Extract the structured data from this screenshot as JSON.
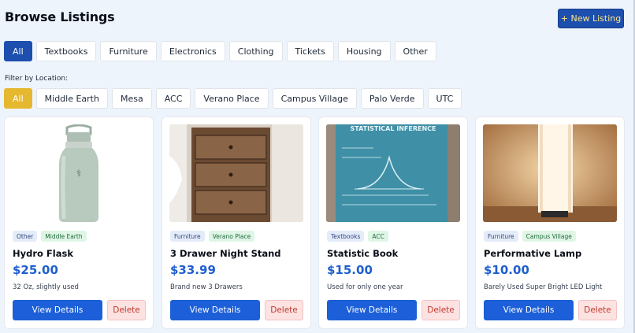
{
  "header": {
    "title": "Browse Listings",
    "new_listing_label": "+ New Listing"
  },
  "categories": [
    "All",
    "Textbooks",
    "Furniture",
    "Electronics",
    "Clothing",
    "Tickets",
    "Housing",
    "Other"
  ],
  "selected_category": "All",
  "location_filter": {
    "label": "Filter by Location:",
    "options": [
      "All",
      "Middle Earth",
      "Mesa",
      "ACC",
      "Verano Place",
      "Campus Village",
      "Palo Verde",
      "UTC"
    ],
    "selected": "All"
  },
  "listings": [
    {
      "category": "Other",
      "location": "Middle Earth",
      "title": "Hydro Flask",
      "price": "$25.00",
      "description": "32 Oz, slightly used",
      "image": "water-bottle-photo"
    },
    {
      "category": "Furniture",
      "location": "Verano Place",
      "title": "3 Drawer Night Stand",
      "price": "$33.99",
      "description": "Brand new 3 Drawers",
      "image": "nightstand-photo"
    },
    {
      "category": "Textbooks",
      "location": "ACC",
      "title": "Statistic Book",
      "price": "$15.00",
      "description": "Used for only one year",
      "image": "textbook-photo",
      "image_text": "STATISTICAL INFERENCE"
    },
    {
      "category": "Furniture",
      "location": "Campus Village",
      "title": "Performative Lamp",
      "price": "$10.00",
      "description": "Barely Used Super Bright LED Light",
      "image": "lamp-photo"
    }
  ],
  "card_actions": {
    "view_label": "View Details",
    "delete_label": "Delete"
  },
  "colors": {
    "background": "#eef4fc",
    "primary": "#1c5fd8",
    "primary_dark": "#1d4fae",
    "location_active": "#e6b82f",
    "price": "#1f5fcf",
    "delete_bg": "#fde2e2",
    "delete_text": "#c0392b"
  }
}
